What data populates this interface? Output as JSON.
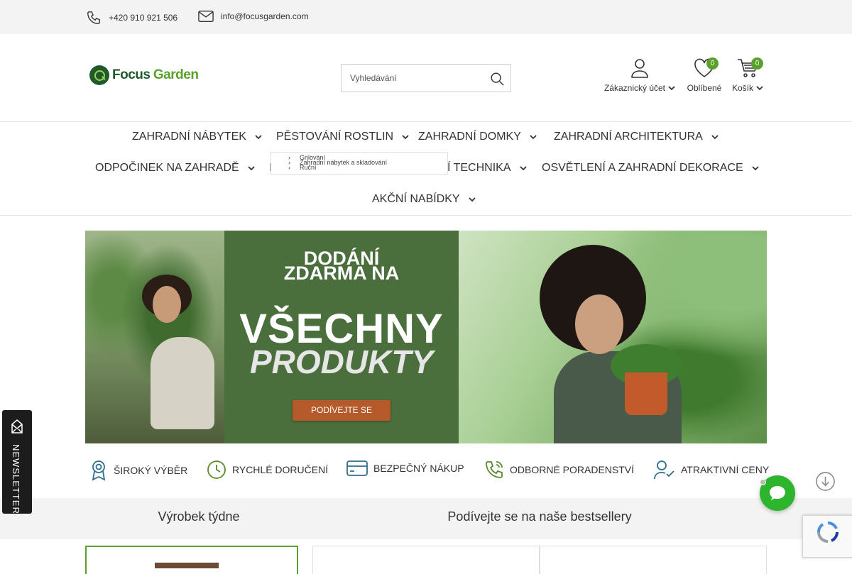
{
  "topbar": {
    "phone": "+420 910 921 506",
    "email": "info@focusgarden.com"
  },
  "header": {
    "logo_part1": "Focus",
    "logo_part2": "Garden",
    "search_placeholder": "Vyhledávání",
    "account_label": "Zákaznický účet",
    "favorites_label": "Oblíbené",
    "favorites_count": "0",
    "cart_label": "Košík",
    "cart_count": "0"
  },
  "nav": {
    "items": [
      {
        "label": "ZAHRADNÍ NÁBYTEK"
      },
      {
        "label": "PĚSTOVÁNÍ ROSTLIN"
      },
      {
        "label": "ZAHRADNÍ DOMKY"
      },
      {
        "label": "ZAHRADNÍ ARCHITEKTURA"
      },
      {
        "label": "ODPOČINEK NA ZAHRADĚ"
      },
      {
        "label": "I"
      },
      {
        "label": "Í TECHNIKA"
      },
      {
        "label": "OSVĚTLENÍ A ZAHRADNÍ DEKORACE"
      },
      {
        "label": "AKČNÍ NABÍDKY"
      }
    ],
    "dropdown_lines": [
      "Grilování",
      "Zahradní nábytek a skladování",
      "Ruční"
    ]
  },
  "hero": {
    "line1": "DODÁNÍ",
    "line2": "ZDARMA NA",
    "line3": "VŠECHNY",
    "line4": "PRODUKTY",
    "cta": "PODÍVEJTE SE"
  },
  "benefits": [
    {
      "label": "ŠIROKÝ VÝBĚR",
      "icon": "award-icon"
    },
    {
      "label": "RYCHLÉ DORUČENÍ",
      "icon": "clock-icon"
    },
    {
      "label": "BEZPEČNÝ NÁKUP",
      "icon": "credit-card-icon"
    },
    {
      "label": "ODBORNÉ PORADENSTVÍ",
      "icon": "phone-call-icon"
    },
    {
      "label": "ATRAKTIVNÍ CENY",
      "icon": "user-check-icon"
    }
  ],
  "sections": {
    "product_of_week": "Výrobek týdne",
    "bestsellers": "Podívejte se na naše bestsellery"
  },
  "newsletter_label": "NEWSLETTER",
  "colors": {
    "brand_dark": "#1f5a2e",
    "brand_green": "#5aa12c",
    "hero_green": "#4a6e3c",
    "cta": "#b55a2a",
    "chat": "#2db52d"
  }
}
